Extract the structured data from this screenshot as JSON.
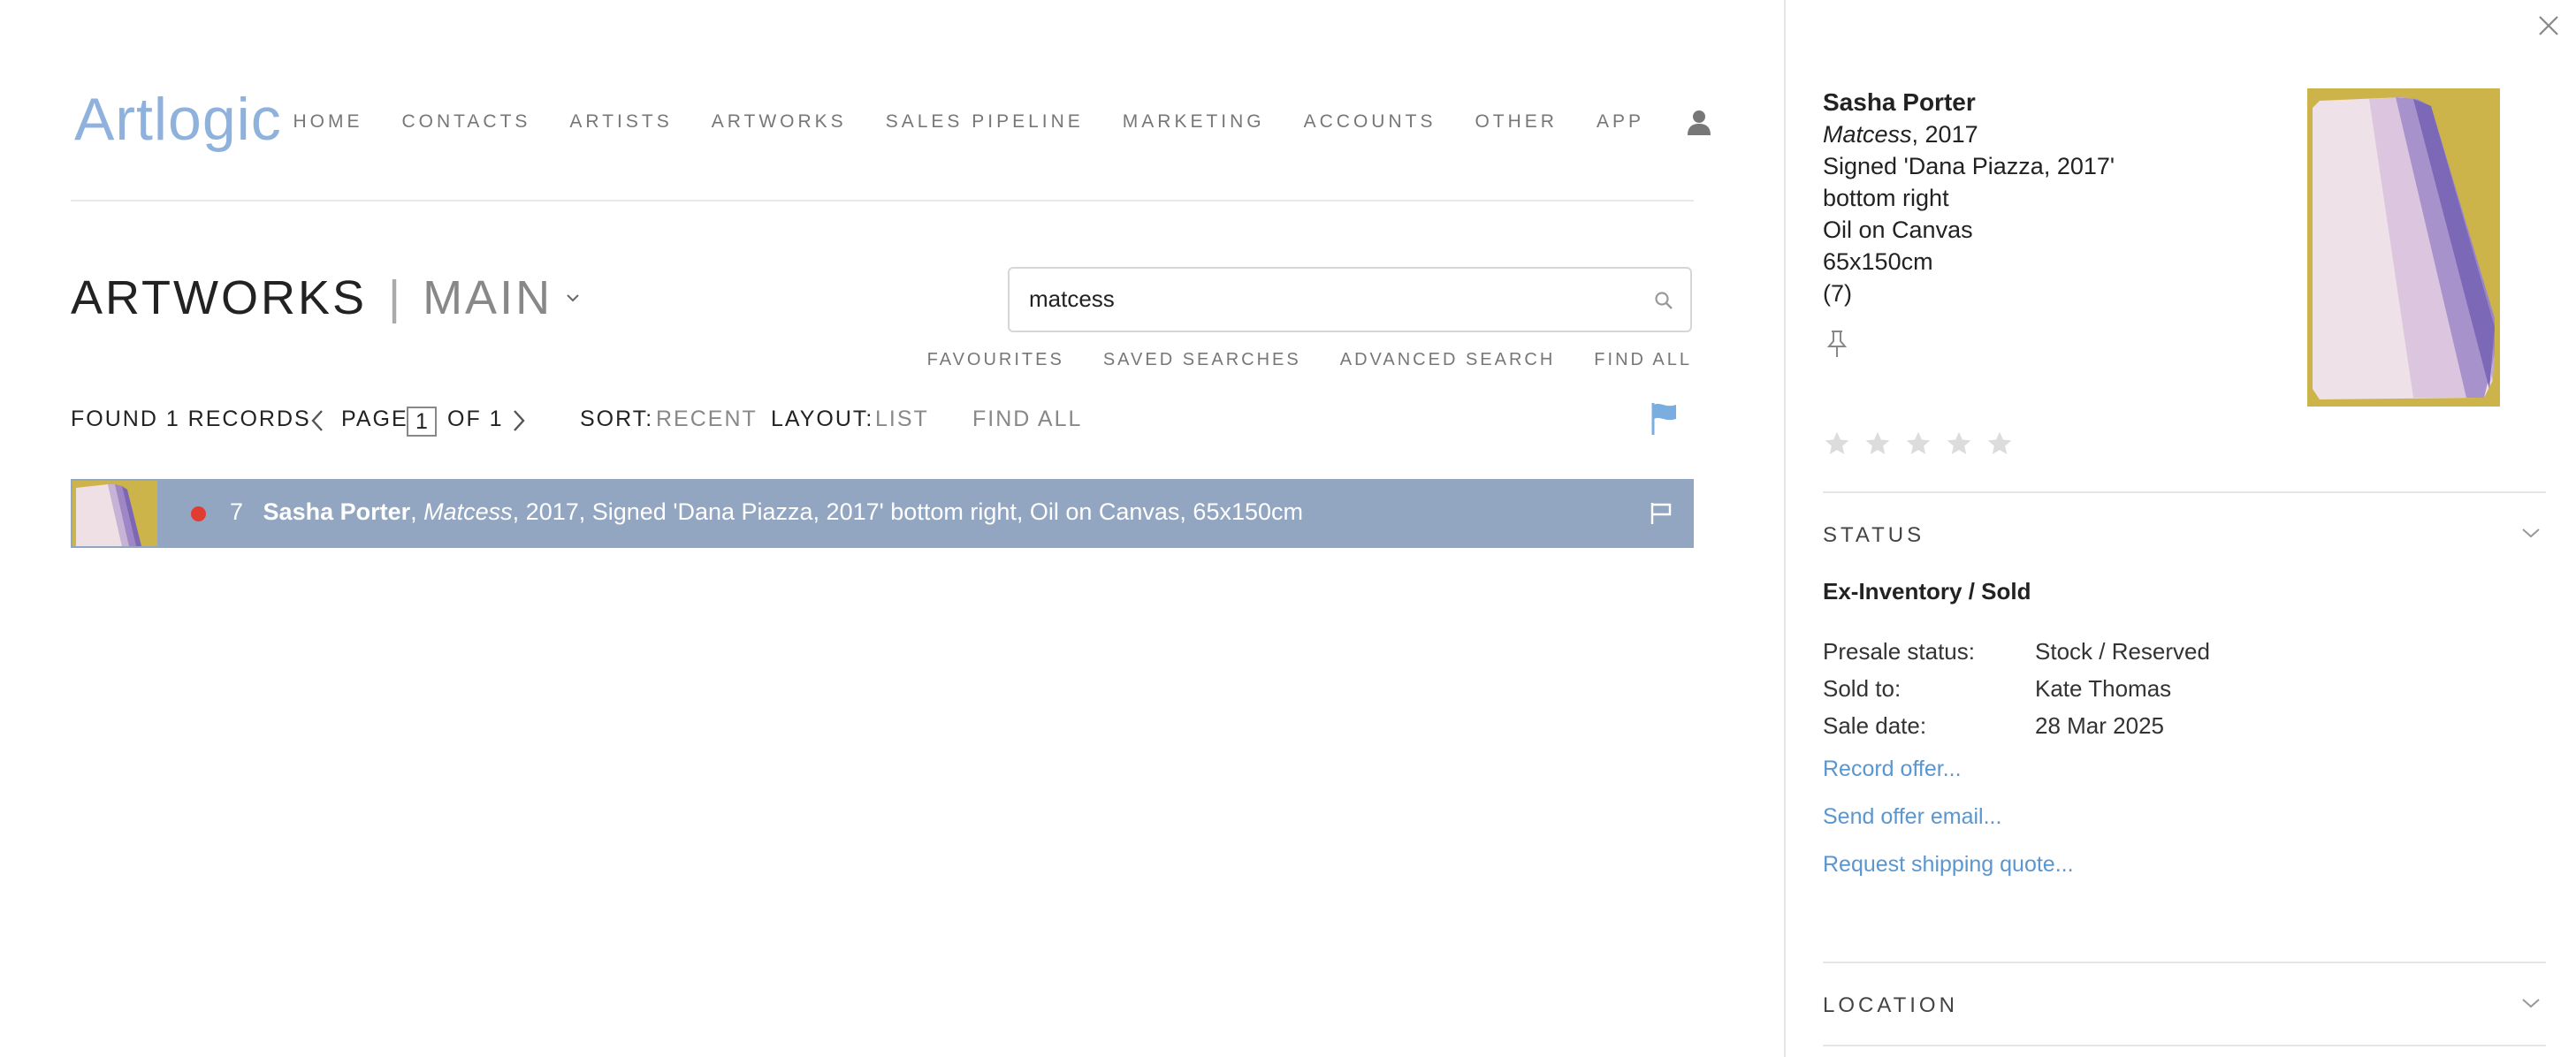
{
  "app": {
    "logo": "Artlogic"
  },
  "nav": {
    "items": [
      "HOME",
      "CONTACTS",
      "ARTISTS",
      "ARTWORKS",
      "SALES PIPELINE",
      "MARKETING",
      "ACCOUNTS",
      "OTHER",
      "APP"
    ],
    "user_icon": "user-icon"
  },
  "page": {
    "title": "ARTWORKS",
    "subtitle": "MAIN",
    "separator": "|"
  },
  "search": {
    "value": "matcess",
    "icon": "search-icon"
  },
  "search_links": [
    "FAVOURITES",
    "SAVED SEARCHES",
    "ADVANCED SEARCH",
    "FIND ALL"
  ],
  "toolbar": {
    "found_prefix": "FOUND ",
    "found_count": "1",
    "found_suffix": " RECORDS",
    "page_label": "PAGE",
    "page_current": "1",
    "page_of": "OF 1",
    "sort_label": "SORT:",
    "sort_value": "RECENT",
    "layout_label": "LAYOUT:",
    "layout_value": "LIST",
    "find_all": "FIND ALL",
    "flag_color": "#7aaee0"
  },
  "results": [
    {
      "number": "7",
      "artist": "Sasha Porter",
      "title": "Matcess",
      "details": ", 2017, Signed 'Dana Piazza, 2017' bottom right, Oil on Canvas, 65x150cm",
      "status_dot_color": "#e03c31"
    }
  ],
  "detail": {
    "artist": "Sasha Porter",
    "title": "Matcess",
    "year": ", 2017",
    "signed": "Signed 'Dana Piazza, 2017'",
    "signed_position": "bottom right",
    "medium": "Oil on Canvas",
    "dimensions": "65x150cm",
    "stock": "(7)",
    "rating": 0,
    "status_section": "STATUS",
    "status_value": "Ex-Inventory / Sold",
    "fields": [
      {
        "label": "Presale status:",
        "value": "Stock / Reserved"
      },
      {
        "label": "Sold to:",
        "value": "Kate Thomas"
      },
      {
        "label": "Sale date:",
        "value": "28 Mar 2025"
      }
    ],
    "actions": [
      "Record offer...",
      "Send offer email...",
      "Request shipping quote..."
    ],
    "location_section": "LOCATION"
  },
  "colors": {
    "accent": "#8fb2dd",
    "row_bg": "#92a6c1",
    "link": "#5a96cf"
  }
}
